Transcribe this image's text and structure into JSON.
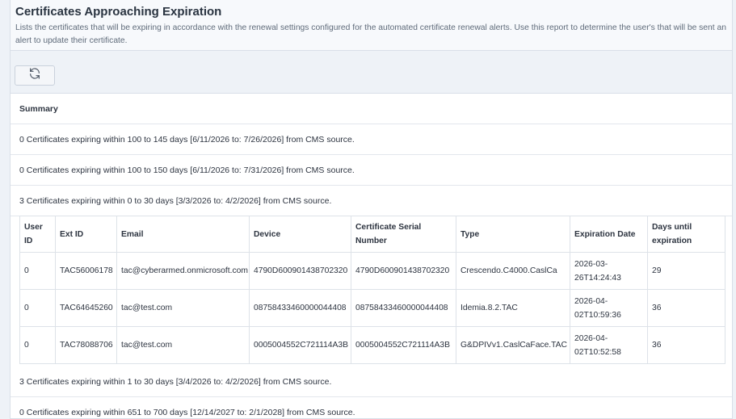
{
  "header": {
    "title": "Certificates Approaching Expiration",
    "description": "Lists the certificates that will be expiring in accordance with the renewal settings configured for the automated certificate renewal alerts. Use this report to determine the user's that will be sent an alert to update their certificate."
  },
  "toolbar": {
    "refresh_icon": "refresh-icon"
  },
  "summary": {
    "label": "Summary"
  },
  "groups": [
    {
      "text": "0 Certificates expiring within 100 to 145 days [6/11/2026 to: 7/26/2026] from CMS source."
    },
    {
      "text": "0 Certificates expiring within 100 to 150 days [6/11/2026 to: 7/31/2026] from CMS source."
    },
    {
      "text": "3 Certificates expiring within 0 to 30 days [3/3/2026 to: 4/2/2026] from CMS source."
    },
    {
      "text": "3 Certificates expiring within 1 to 30 days [3/4/2026 to: 4/2/2026] from CMS source."
    },
    {
      "text": "0 Certificates expiring within 651 to 700 days [12/14/2027 to: 2/1/2028] from CMS source."
    }
  ],
  "table": {
    "columns": [
      "User ID",
      "Ext ID",
      "Email",
      "Device",
      "Certificate Serial Number",
      "Type",
      "Expiration Date",
      "Days until expiration"
    ],
    "rows": [
      [
        "0",
        "TAC56006178",
        "tac@cyberarmed.onmicrosoft.com",
        "4790D600901438702320",
        "4790D600901438702320",
        "Crescendo.C4000.CaslCa",
        "2026-03-26T14:24:43",
        "29"
      ],
      [
        "0",
        "TAC64645260",
        "tac@test.com",
        "08758433460000044408",
        "08758433460000044408",
        "Idemia.8.2.TAC",
        "2026-04-02T10:59:36",
        "36"
      ],
      [
        "0",
        "TAC78088706",
        "tac@test.com",
        "0005004552C721114A3B",
        "0005004552C721114A3B",
        "G&DPIVv1.CaslCaFace.TAC",
        "2026-04-02T10:52:58",
        "36"
      ]
    ]
  }
}
